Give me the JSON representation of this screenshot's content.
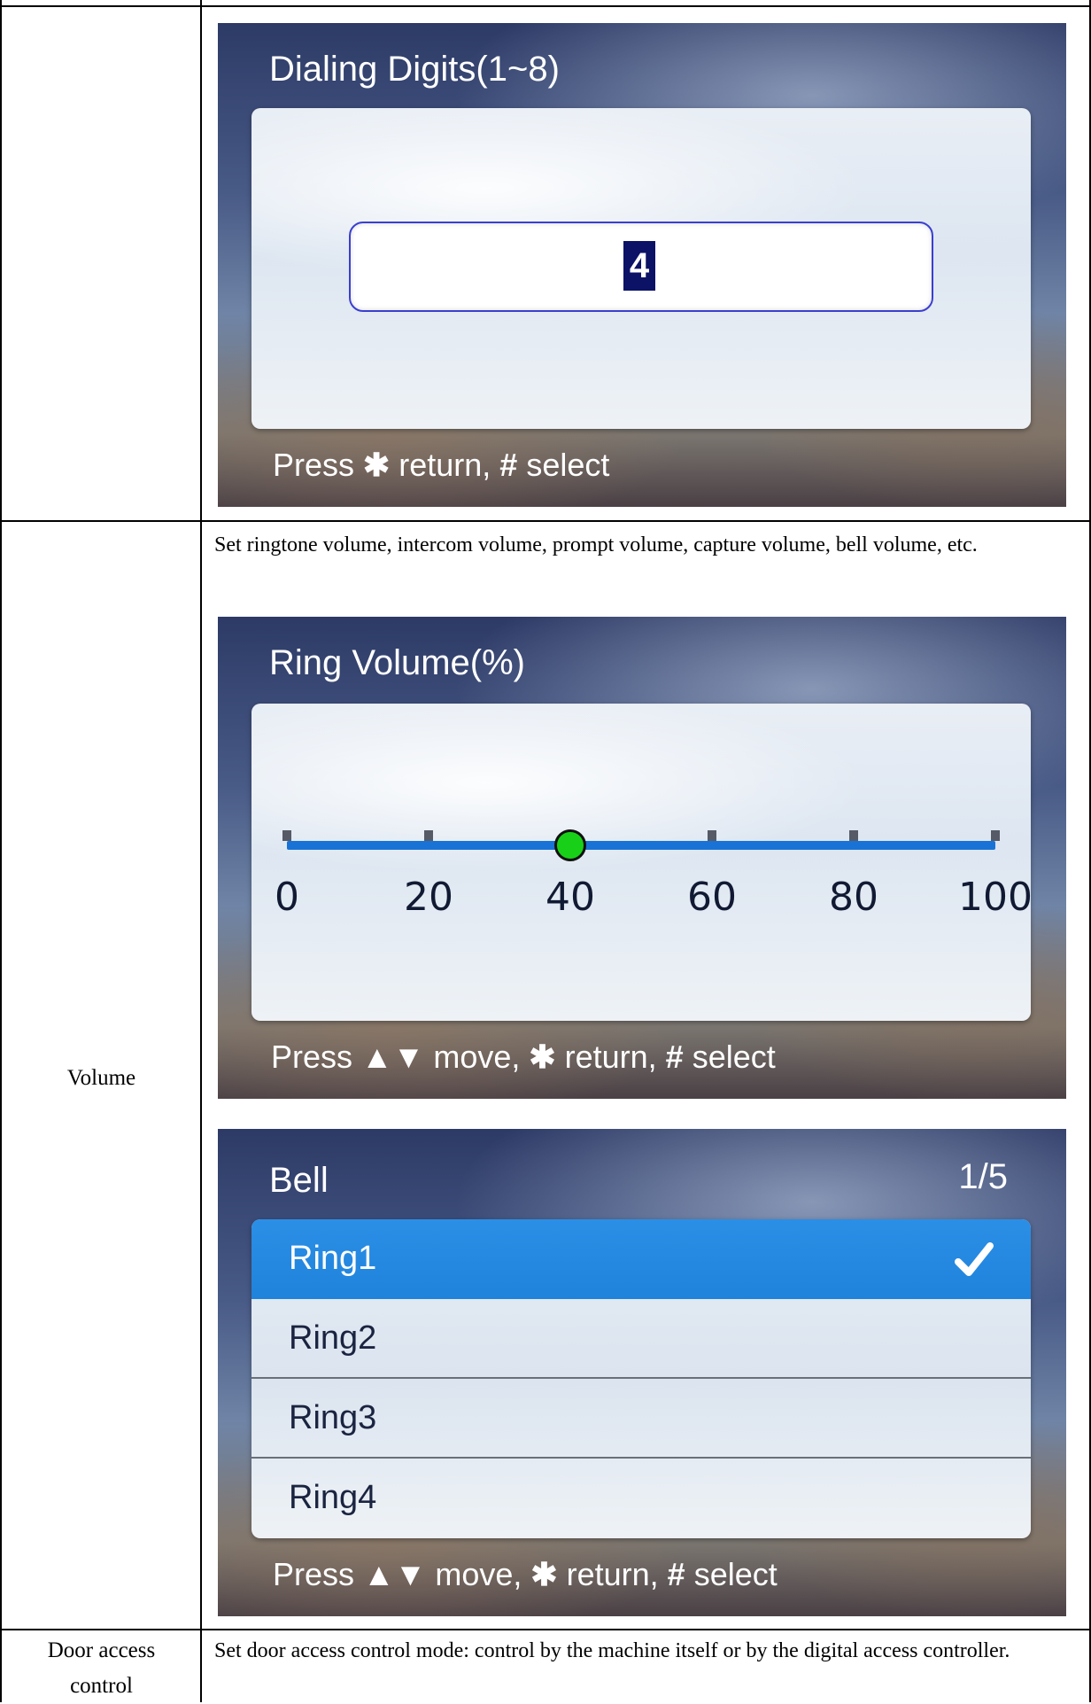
{
  "table": {
    "row1": {
      "screen": {
        "title": "Dialing Digits(1~8)",
        "value": "4",
        "hint": {
          "press": "Press",
          "star": "✱",
          "return_text": "return,",
          "hash": "#",
          "select_text": "select"
        }
      }
    },
    "row2": {
      "label": "Volume",
      "description": "Set ringtone volume, intercom volume, prompt volume, capture volume, bell volume, etc.",
      "volume_screen": {
        "title": "Ring Volume(%)",
        "slider": {
          "value": 40,
          "min": 0,
          "max": 100,
          "ticks": [
            "0",
            "20",
            "40",
            "60",
            "80",
            "100"
          ]
        },
        "hint": {
          "press": "Press",
          "arrows": "▲▼",
          "move_text": "move,",
          "star": "✱",
          "return_text": "return,",
          "hash": "#",
          "select_text": "select"
        }
      },
      "bell_screen": {
        "title": "Bell",
        "counter": "1/5",
        "items": [
          {
            "label": "Ring1",
            "selected": true
          },
          {
            "label": "Ring2",
            "selected": false
          },
          {
            "label": "Ring3",
            "selected": false
          },
          {
            "label": "Ring4",
            "selected": false
          }
        ],
        "check_icon": "checkmark-icon",
        "hint": {
          "press": "Press",
          "arrows": "▲▼",
          "move_text": "move,",
          "star": "✱",
          "return_text": "return,",
          "hash": "#",
          "select_text": "select"
        }
      }
    },
    "row3": {
      "label_line1": "Door access",
      "label_line2": "control",
      "description": "Set door access control mode: control by the machine itself or by the digital access controller."
    }
  }
}
